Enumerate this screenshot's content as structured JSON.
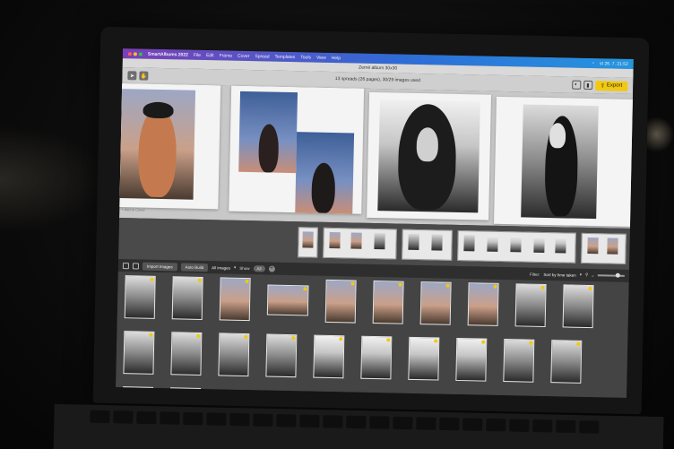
{
  "menubar": {
    "app_name": "SmartAlbums 2022",
    "items": [
      "File",
      "Edit",
      "Frame",
      "Cover",
      "Spread",
      "Templates",
      "Tools",
      "View",
      "Help"
    ],
    "clock": "st 26. 7. 21:52",
    "traffic_colors": [
      "#ff5f57",
      "#febc2e",
      "#28c840"
    ]
  },
  "window": {
    "title": "Zerné album 30x30"
  },
  "toolbar": {
    "spread_info": "13 spreads (26 pages), 30/29 images used",
    "export_label": "Export",
    "accent": "#f2c90f"
  },
  "canvas": {
    "add_text": "+ Add to Cover"
  },
  "library_bar": {
    "import_label": "Import Images",
    "auto_label": "Auto Build",
    "filter_all": "All images",
    "show_label": "Show",
    "all_pill": "All",
    "filter_label": "Filter:",
    "sort_label": "Sort by time taken"
  }
}
